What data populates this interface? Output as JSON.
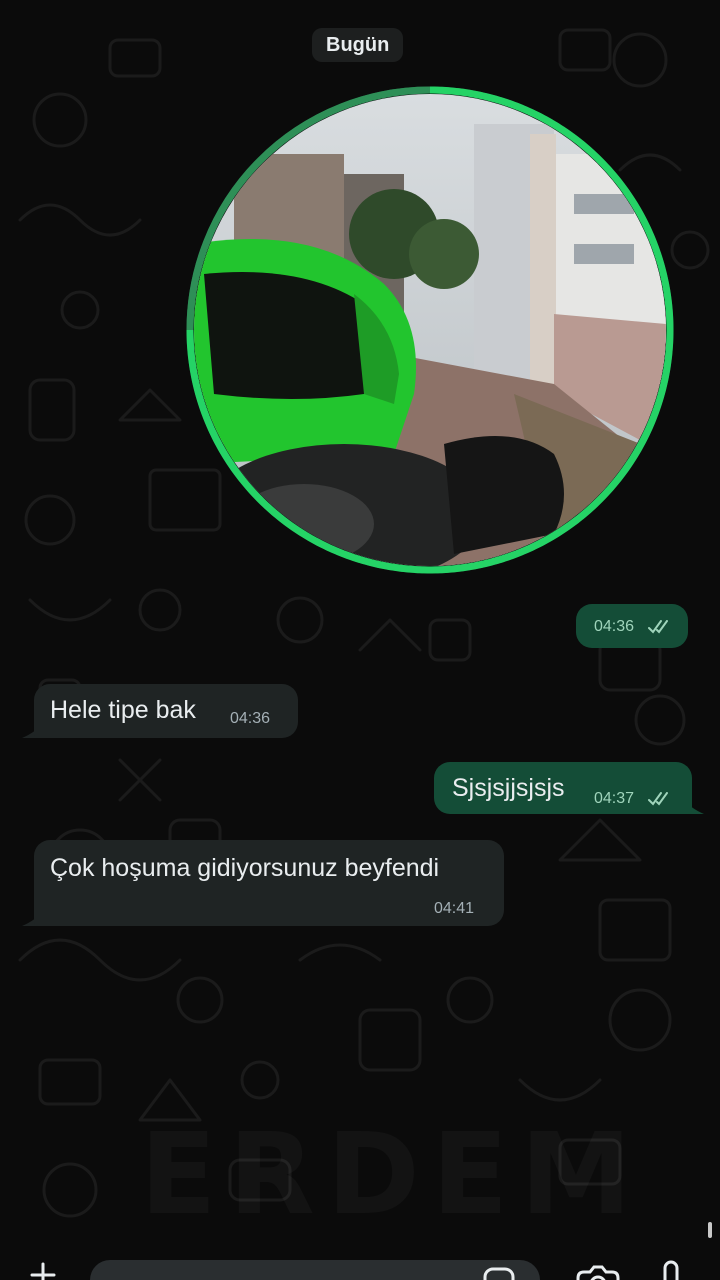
{
  "chat": {
    "date_separator": "Bugün",
    "video_message": {
      "time": "04:36",
      "status": "read",
      "icon": "double-check-icon",
      "progress_ring_accent": "#25d366"
    },
    "messages": [
      {
        "direction": "incoming",
        "text": "Hele tipe bak",
        "time": "04:36"
      },
      {
        "direction": "outgoing",
        "text": "Sjsjsjjsjsjs",
        "time": "04:37",
        "status": "read"
      },
      {
        "direction": "incoming",
        "text": "Çok hoşuma gidiyorsunuz beyfendi",
        "time": "04:41"
      }
    ]
  },
  "watermark": "ERDEM",
  "composer": {
    "icons": [
      "plus-icon",
      "sticker-icon",
      "camera-icon",
      "mic-icon"
    ]
  },
  "colors": {
    "background": "#0b0b0b",
    "incoming_bubble": "#1f2424",
    "outgoing_bubble": "#144d37",
    "accent": "#25d366"
  }
}
